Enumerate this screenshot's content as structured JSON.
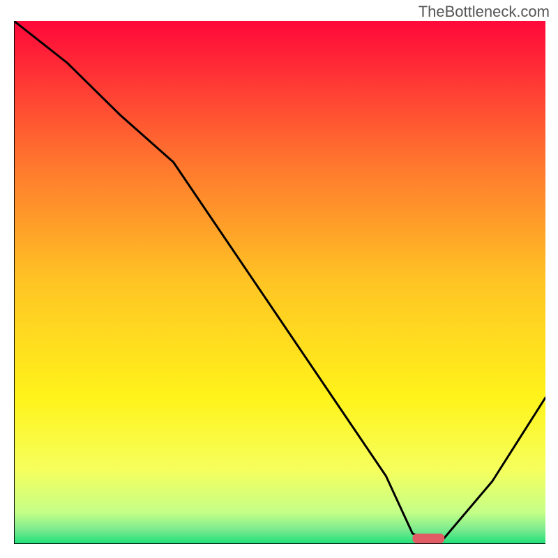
{
  "watermark": "TheBottleneck.com",
  "chart_data": {
    "type": "line",
    "title": "",
    "xlabel": "",
    "ylabel": "",
    "xlim": [
      0,
      100
    ],
    "ylim": [
      0,
      100
    ],
    "grid": false,
    "x": [
      0,
      10,
      20,
      30,
      40,
      50,
      60,
      70,
      75,
      80,
      90,
      100
    ],
    "values": [
      100,
      92,
      82,
      73,
      58,
      43,
      28,
      13,
      2,
      0,
      12,
      28
    ],
    "gradient_stops": [
      {
        "offset": 0.0,
        "color": "#ff083a"
      },
      {
        "offset": 0.25,
        "color": "#ff6e2f"
      },
      {
        "offset": 0.5,
        "color": "#ffc524"
      },
      {
        "offset": 0.72,
        "color": "#fff31a"
      },
      {
        "offset": 0.86,
        "color": "#f5ff5e"
      },
      {
        "offset": 0.94,
        "color": "#c4ff88"
      },
      {
        "offset": 0.975,
        "color": "#74e98e"
      },
      {
        "offset": 1.0,
        "color": "#1be079"
      }
    ],
    "optimal_marker": {
      "x": 78,
      "width": 6
    }
  }
}
